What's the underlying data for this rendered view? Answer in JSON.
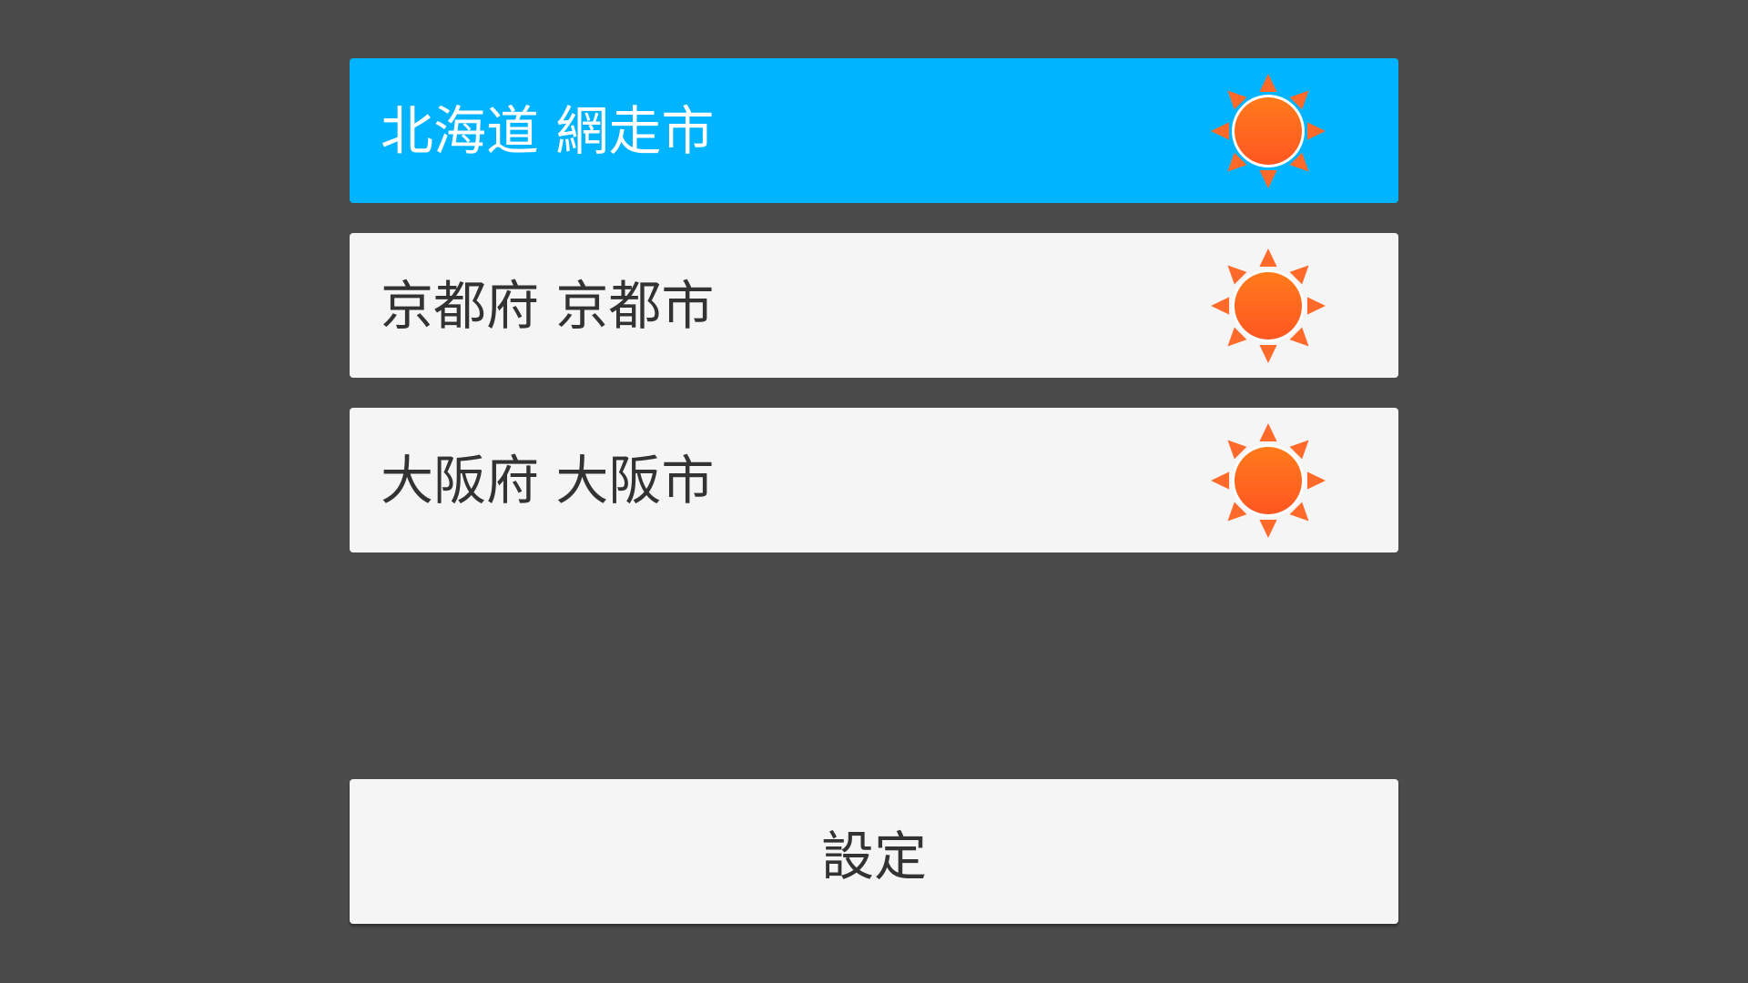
{
  "cities": [
    {
      "name": "北海道 網走市",
      "weather_icon": "sun-icon",
      "selected": true
    },
    {
      "name": "京都府 京都市",
      "weather_icon": "sun-icon",
      "selected": false
    },
    {
      "name": "大阪府 大阪市",
      "weather_icon": "sun-icon",
      "selected": false
    }
  ],
  "settings_button": {
    "label": "設定"
  },
  "colors": {
    "background": "#4b4b4b",
    "selected_row": "#00b4ff",
    "row": "#f5f5f5",
    "sun": "#ff5722",
    "sun_rays": "#ff6a2a"
  }
}
